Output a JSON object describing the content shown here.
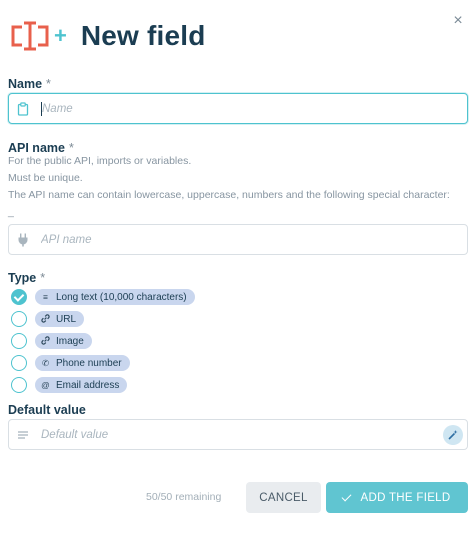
{
  "dialog": {
    "title": "New field",
    "plus_glyph": "+",
    "close_glyph": "×",
    "icon": "field-text-cursor-icon",
    "accent_color": "#4ec3cf",
    "brand_icon_color": "#e8604c"
  },
  "name_field": {
    "label": "Name",
    "required_mark": "*",
    "placeholder": "Name",
    "value": "",
    "icon": "clipboard-icon"
  },
  "api_field": {
    "label": "API name",
    "required_mark": "*",
    "help_lines": [
      "For the public API, imports or variables.",
      "Must be unique.",
      "The API name can contain lowercase, uppercase, numbers and the following special character: _"
    ],
    "placeholder": "API name",
    "value": "",
    "icon": "plug-icon"
  },
  "type_field": {
    "label": "Type",
    "required_mark": "*",
    "options": [
      {
        "label": "Long text (10,000 characters)",
        "icon": "text-lines-icon",
        "glyph": "≡",
        "checked": true
      },
      {
        "label": "URL",
        "icon": "link-icon",
        "glyph": "∂",
        "checked": false
      },
      {
        "label": "Image",
        "icon": "link-icon",
        "glyph": "∂",
        "checked": false
      },
      {
        "label": "Phone number",
        "icon": "phone-icon",
        "glyph": "✆",
        "checked": false
      },
      {
        "label": "Email address",
        "icon": "at-icon",
        "glyph": "@",
        "checked": false
      }
    ]
  },
  "default_field": {
    "label": "Default value",
    "placeholder": "Default value",
    "value": "",
    "icon": "lines-icon",
    "action_icon": "magic-wand-icon"
  },
  "footer": {
    "remaining": "50/50 remaining",
    "cancel_label": "CANCEL",
    "add_label": "ADD THE FIELD"
  }
}
